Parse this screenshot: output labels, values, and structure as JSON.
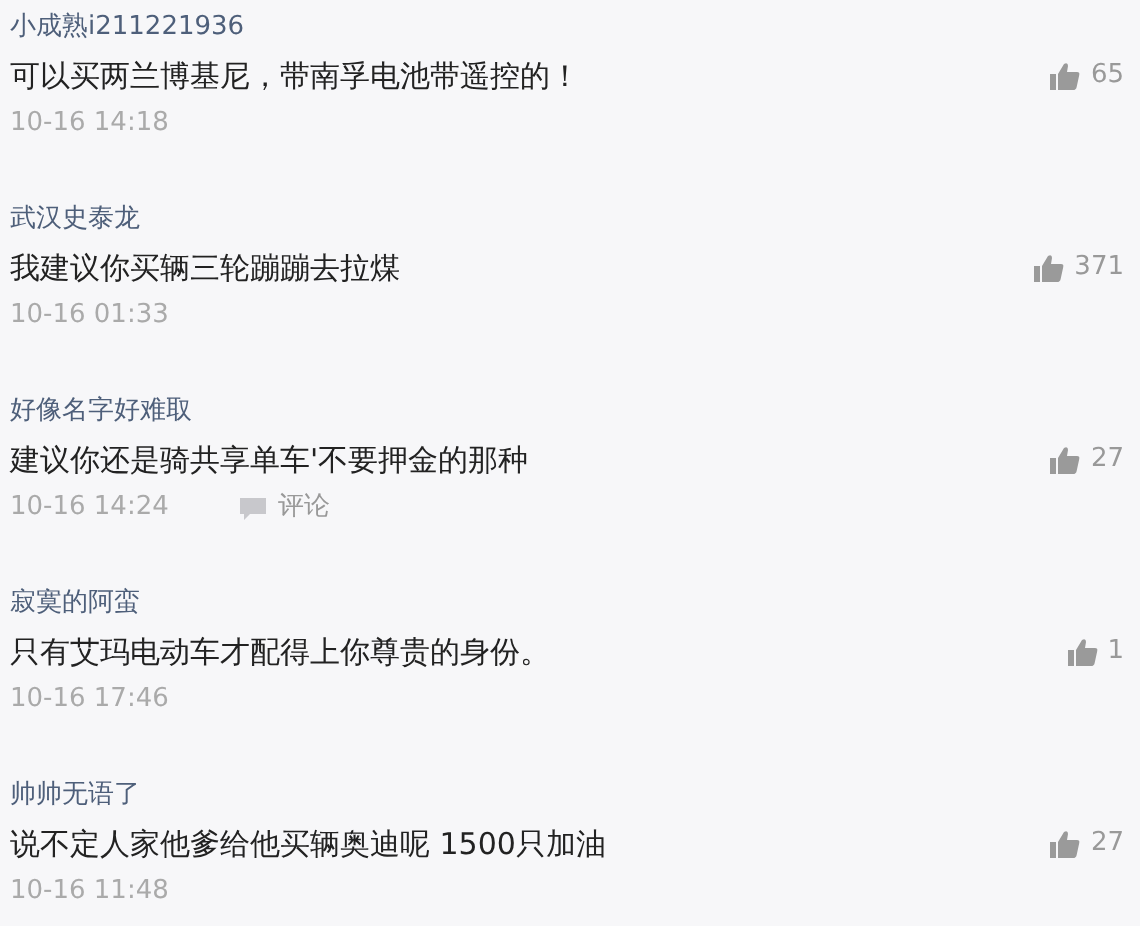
{
  "comments": [
    {
      "author": "小成熟i211221936",
      "text": "可以买两兰博基尼，带南孚电池带遥控的！",
      "likes": "65",
      "time": "10-16 14:18"
    },
    {
      "author": "武汉史泰龙",
      "text": "我建议你买辆三轮蹦蹦去拉煤",
      "likes": "371",
      "time": "10-16 01:33"
    },
    {
      "author": "好像名字好难取",
      "text": "建议你还是骑共享单车'不要押金的那种",
      "likes": "27",
      "time": "10-16 14:24",
      "reply": "评论"
    },
    {
      "author": "寂寞的阿蛮",
      "text": "只有艾玛电动车才配得上你尊贵的身份。",
      "likes": "1",
      "time": "10-16 17:46"
    },
    {
      "author": "帅帅无语了",
      "text": "说不定人家他爹给他买辆奥迪呢 1500只加油",
      "likes": "27",
      "time": "10-16 11:48"
    }
  ]
}
